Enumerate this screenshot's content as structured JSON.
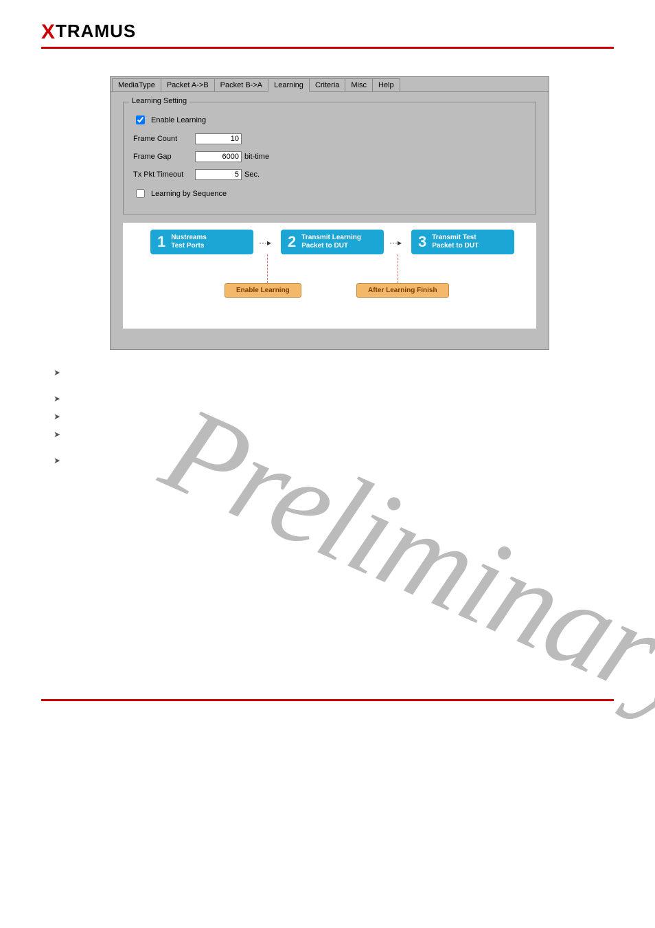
{
  "header": {
    "logo_x": "X",
    "logo_rest": "TRAMUS"
  },
  "tabs": [
    {
      "label": "MediaType"
    },
    {
      "label": "Packet A->B"
    },
    {
      "label": "Packet B->A"
    },
    {
      "label": "Learning",
      "active": true
    },
    {
      "label": "Criteria"
    },
    {
      "label": "Misc"
    },
    {
      "label": "Help"
    }
  ],
  "group": {
    "legend": "Learning Setting",
    "enable_label": "Enable Learning",
    "enable_checked": true,
    "frame_count_label": "Frame Count",
    "frame_count_value": "10",
    "frame_gap_label": "Frame Gap",
    "frame_gap_value": "6000",
    "frame_gap_unit": "bit-time",
    "tx_timeout_label": "Tx Pkt Timeout",
    "tx_timeout_value": "5",
    "tx_timeout_unit": "Sec.",
    "seq_label": "Learning by Sequence",
    "seq_checked": false
  },
  "flow": {
    "step1_num": "1",
    "step1_line1": "Nustreams",
    "step1_line2": "Test Ports",
    "step2_num": "2",
    "step2_line1": "Transmit Learning",
    "step2_line2": "Packet to DUT",
    "step3_num": "3",
    "step3_line1": "Transmit Test",
    "step3_line2": "Packet to DUT",
    "label1": "Enable Learning",
    "label2": "After Learning Finish"
  },
  "watermark": "Preliminary"
}
